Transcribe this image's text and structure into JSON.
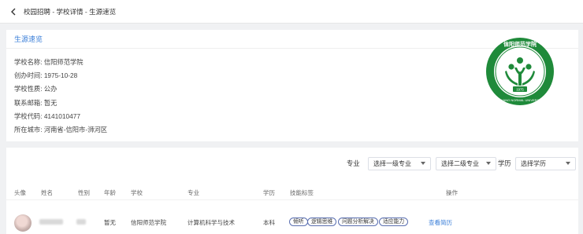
{
  "breadcrumb": "校园招聘 - 学校详情 - 生源速览",
  "section_title": "生源速览",
  "school_info": [
    {
      "label": "学校名称:",
      "value": "信阳师范学院"
    },
    {
      "label": "创办时间:",
      "value": "1975-10-28"
    },
    {
      "label": "学校性质:",
      "value": "公办"
    },
    {
      "label": "联系邮箱:",
      "value": "暂无"
    },
    {
      "label": "学校代码:",
      "value": "4141010477"
    },
    {
      "label": "所在城市:",
      "value": "河南省-信阳市-浉河区"
    }
  ],
  "logo": {
    "text": "信阳师范学院",
    "year": "1975",
    "ring_text": "XINYANG NORMAL UNIVERSITY",
    "color": "#1f8a3a"
  },
  "filters": {
    "major_label": "专业",
    "major1_placeholder": "选择一级专业",
    "major2_placeholder": "选择二级专业",
    "degree_label": "学历",
    "degree_placeholder": "选择学历"
  },
  "table": {
    "headers": [
      "头像",
      "姓名",
      "性别",
      "年龄",
      "学校",
      "专业",
      "学历",
      "技能标签",
      "操作"
    ],
    "row": {
      "age": "暂无",
      "school": "信阳师范学院",
      "major": "计算机科学与技术",
      "degree": "本科",
      "tags": [
        "倾听",
        "逻辑思维",
        "问题分析解决",
        "适应能力"
      ],
      "action": "查看简历"
    }
  },
  "colors": {
    "accent": "#3b7fd8",
    "tag_border": "#5a6fb0",
    "bg": "#f0f1f3"
  }
}
